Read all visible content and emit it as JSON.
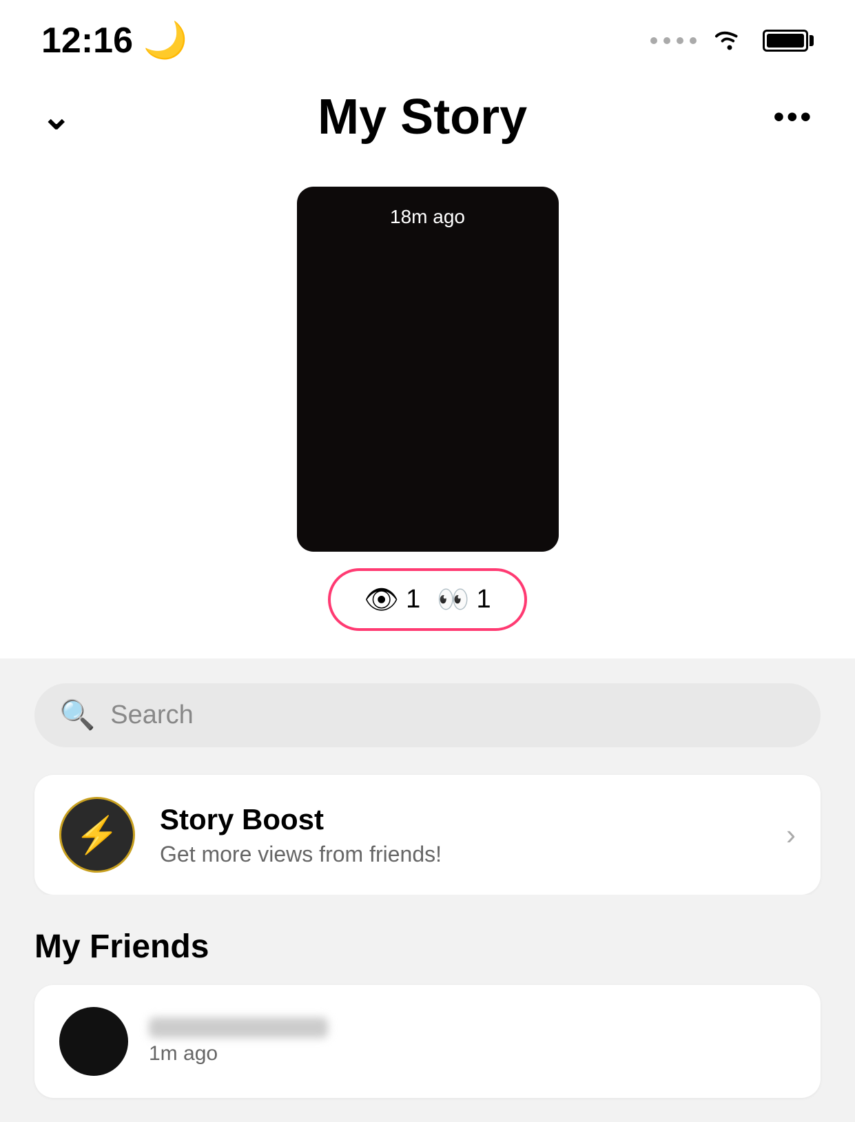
{
  "statusBar": {
    "time": "12:16",
    "moonIcon": "🌙"
  },
  "header": {
    "backLabel": "⌄",
    "title": "My Story",
    "moreLabel": "•••"
  },
  "storyThumbnail": {
    "timestamp": "18m ago"
  },
  "storyStats": {
    "viewIcon": "👁",
    "viewCount": "1",
    "eyesEmoji": "👀",
    "screenshotCount": "1"
  },
  "search": {
    "placeholder": "Search"
  },
  "storyBoost": {
    "title": "Story Boost",
    "subtitle": "Get more views from friends!",
    "chevron": "›"
  },
  "friends": {
    "sectionTitle": "My Friends",
    "items": [
      {
        "timeAgo": "1m ago"
      }
    ]
  }
}
